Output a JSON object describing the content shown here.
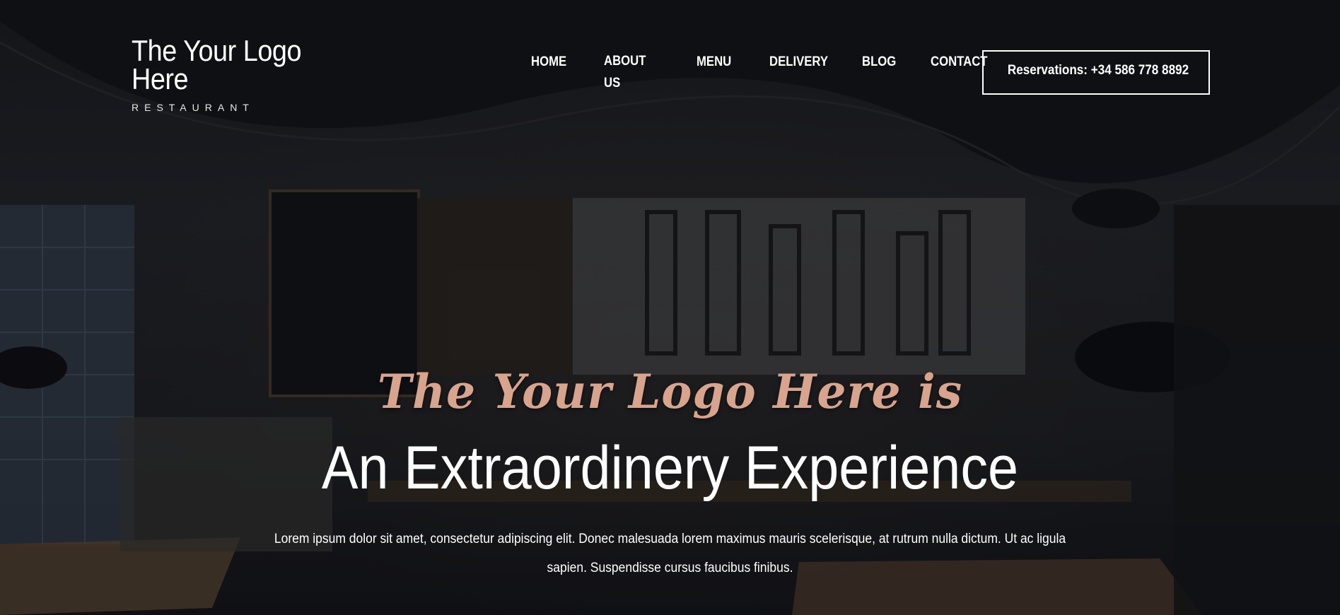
{
  "logo": {
    "title": "The Your Logo Here",
    "subtitle": "RESTAURANT"
  },
  "nav": {
    "items": [
      {
        "label": "HOME"
      },
      {
        "label": "ABOUT US"
      },
      {
        "label": "MENU"
      },
      {
        "label": "DELIVERY"
      },
      {
        "label": "BLOG"
      },
      {
        "label": "CONTACT"
      }
    ],
    "reservation_label": "Reservations: +34 586 778 8892"
  },
  "hero": {
    "script_title": "The Your Logo Here is",
    "headline": "An Extraordinery Experience",
    "description": "Lorem ipsum dolor sit amet, consectetur adipiscing elit. Donec malesuada lorem maximus mauris scelerisque, at rutrum nulla dictum. Ut ac ligula sapien. Suspendisse cursus faucibus finibus."
  },
  "colors": {
    "accent_script": "#d8a48e",
    "text": "#ffffff",
    "background": "#1e2023"
  }
}
